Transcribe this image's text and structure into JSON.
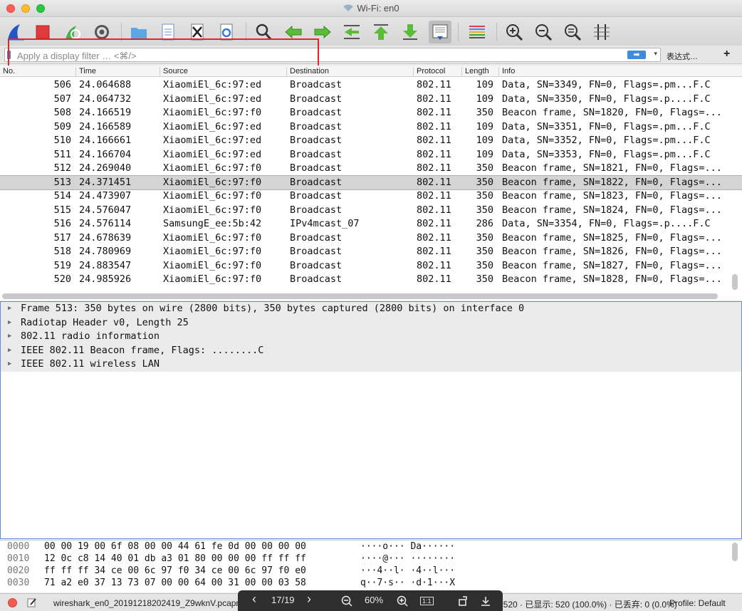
{
  "window": {
    "title": "Wi-Fi: en0"
  },
  "toolbar": {
    "icons": [
      "shark-fin-start-icon",
      "stop-capture-icon",
      "restart-capture-icon",
      "capture-options-icon",
      "open-folder-icon",
      "save-file-icon",
      "close-file-icon",
      "reload-icon",
      "find-packet-icon",
      "go-back-icon",
      "go-forward-icon",
      "go-to-packet-icon",
      "go-first-icon",
      "go-last-icon",
      "autoscroll-icon",
      "colorize-icon",
      "zoom-in-icon",
      "zoom-out-icon",
      "zoom-normal-icon",
      "resize-columns-icon"
    ]
  },
  "filter": {
    "placeholder": "Apply a display filter … <⌘/>",
    "apply_glyph": "➡",
    "dropdown_glyph": "▾",
    "expression_label": "表达式…",
    "plus_label": "+"
  },
  "packet_list": {
    "columns": [
      "No.",
      "Time",
      "Source",
      "Destination",
      "Protocol",
      "Length",
      "Info"
    ],
    "selected_no": "513",
    "rows": [
      {
        "no": "506",
        "time": "24.064688",
        "src": "XiaomiEl_6c:97:ed",
        "dst": "Broadcast",
        "proto": "802.11",
        "len": "109",
        "info": "Data, SN=3349, FN=0, Flags=.pm...F.C"
      },
      {
        "no": "507",
        "time": "24.064732",
        "src": "XiaomiEl_6c:97:ed",
        "dst": "Broadcast",
        "proto": "802.11",
        "len": "109",
        "info": "Data, SN=3350, FN=0, Flags=.p....F.C"
      },
      {
        "no": "508",
        "time": "24.166519",
        "src": "XiaomiEl_6c:97:f0",
        "dst": "Broadcast",
        "proto": "802.11",
        "len": "350",
        "info": "Beacon frame, SN=1820, FN=0, Flags=..."
      },
      {
        "no": "509",
        "time": "24.166589",
        "src": "XiaomiEl_6c:97:ed",
        "dst": "Broadcast",
        "proto": "802.11",
        "len": "109",
        "info": "Data, SN=3351, FN=0, Flags=.pm...F.C"
      },
      {
        "no": "510",
        "time": "24.166661",
        "src": "XiaomiEl_6c:97:ed",
        "dst": "Broadcast",
        "proto": "802.11",
        "len": "109",
        "info": "Data, SN=3352, FN=0, Flags=.pm...F.C"
      },
      {
        "no": "511",
        "time": "24.166704",
        "src": "XiaomiEl_6c:97:ed",
        "dst": "Broadcast",
        "proto": "802.11",
        "len": "109",
        "info": "Data, SN=3353, FN=0, Flags=.pm...F.C"
      },
      {
        "no": "512",
        "time": "24.269040",
        "src": "XiaomiEl_6c:97:f0",
        "dst": "Broadcast",
        "proto": "802.11",
        "len": "350",
        "info": "Beacon frame, SN=1821, FN=0, Flags=..."
      },
      {
        "no": "513",
        "time": "24.371451",
        "src": "XiaomiEl_6c:97:f0",
        "dst": "Broadcast",
        "proto": "802.11",
        "len": "350",
        "info": "Beacon frame, SN=1822, FN=0, Flags=..."
      },
      {
        "no": "514",
        "time": "24.473907",
        "src": "XiaomiEl_6c:97:f0",
        "dst": "Broadcast",
        "proto": "802.11",
        "len": "350",
        "info": "Beacon frame, SN=1823, FN=0, Flags=..."
      },
      {
        "no": "515",
        "time": "24.576047",
        "src": "XiaomiEl_6c:97:f0",
        "dst": "Broadcast",
        "proto": "802.11",
        "len": "350",
        "info": "Beacon frame, SN=1824, FN=0, Flags=..."
      },
      {
        "no": "516",
        "time": "24.576114",
        "src": "SamsungE_ee:5b:42",
        "dst": "IPv4mcast_07",
        "proto": "802.11",
        "len": "286",
        "info": "Data, SN=3354, FN=0, Flags=.p....F.C"
      },
      {
        "no": "517",
        "time": "24.678639",
        "src": "XiaomiEl_6c:97:f0",
        "dst": "Broadcast",
        "proto": "802.11",
        "len": "350",
        "info": "Beacon frame, SN=1825, FN=0, Flags=..."
      },
      {
        "no": "518",
        "time": "24.780969",
        "src": "XiaomiEl_6c:97:f0",
        "dst": "Broadcast",
        "proto": "802.11",
        "len": "350",
        "info": "Beacon frame, SN=1826, FN=0, Flags=..."
      },
      {
        "no": "519",
        "time": "24.883547",
        "src": "XiaomiEl_6c:97:f0",
        "dst": "Broadcast",
        "proto": "802.11",
        "len": "350",
        "info": "Beacon frame, SN=1827, FN=0, Flags=..."
      },
      {
        "no": "520",
        "time": "24.985926",
        "src": "XiaomiEl_6c:97:f0",
        "dst": "Broadcast",
        "proto": "802.11",
        "len": "350",
        "info": "Beacon frame, SN=1828, FN=0, Flags=..."
      }
    ]
  },
  "details": {
    "rows": [
      "Frame 513: 350 bytes on wire (2800 bits), 350 bytes captured (2800 bits) on interface 0",
      "Radiotap Header v0, Length 25",
      "802.11 radio information",
      "IEEE 802.11 Beacon frame, Flags: ........C",
      "IEEE 802.11 wireless LAN"
    ]
  },
  "bytes": {
    "rows": [
      {
        "off": "0000",
        "hex": "00 00 19 00 6f 08 00 00  44 61 fe 0d 00 00 00 00",
        "ascii": "····o··· Da······"
      },
      {
        "off": "0010",
        "hex": "12 0c c8 14 40 01 db a3  01 80 00 00 00 ff ff ff",
        "ascii": "····@··· ········"
      },
      {
        "off": "0020",
        "hex": "ff ff ff 34 ce 00 6c 97  f0 34 ce 00 6c 97 f0 e0",
        "ascii": "···4··l· ·4··l···"
      },
      {
        "off": "0030",
        "hex": "71 a2 e0 37 13 73 07 00  00 64 00 31 00 00 03 58",
        "ascii": "q··7·s·· ·d·1···X"
      }
    ]
  },
  "status": {
    "file": "wireshark_en0_20191218202419_Z9wknV.pcapng",
    "stats": "分组: 520 · 已显示: 520 (100.0%) · 已丢弃: 0 (0.0%)",
    "profile": "Profile: Default"
  },
  "pager": {
    "prev": "‹",
    "page": "17/19",
    "next": "›",
    "zoom": "60%",
    "actual_size": "1:1"
  },
  "colors": {
    "selected_row": "#d4d4d4",
    "detail_bg": "#ebebeb",
    "highlight": "#e0252b",
    "accent": "#3f8be0"
  }
}
